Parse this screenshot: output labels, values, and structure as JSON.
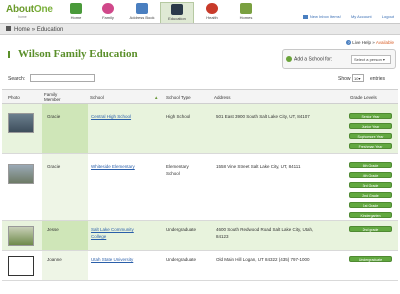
{
  "app": {
    "logo_main": "About",
    "logo_accent": "One",
    "logo_sub": "home"
  },
  "nav": {
    "tabs": [
      {
        "label": "Home",
        "icon": "house-icon",
        "color": "#4a9a3a"
      },
      {
        "label": "Family",
        "icon": "heart-icon",
        "color": "#d0488a"
      },
      {
        "label": "Address Book",
        "icon": "address-book-icon",
        "color": "#4a7fc0"
      },
      {
        "label": "Education",
        "icon": "graduation-cap-icon",
        "color": "#5a8f2a"
      },
      {
        "label": "Health",
        "icon": "apple-icon",
        "color": "#c83a2a"
      },
      {
        "label": "Homes",
        "icon": "homes-icon",
        "color": "#7aa040"
      }
    ],
    "top_links": {
      "inbox": "New Inbox Items!",
      "account": "My Account",
      "logout": "Logout"
    }
  },
  "breadcrumb": {
    "home": "Home",
    "current": "Education"
  },
  "page": {
    "title": "Wilson Family Education",
    "live_help": "Live Help",
    "live_help_status": "Available",
    "add_school_label": "Add a School for:",
    "add_school_select": "Select a person"
  },
  "controls": {
    "search_label": "Search:",
    "show_label": "Show",
    "show_value": "10",
    "entries_label": "entries"
  },
  "table": {
    "headers": {
      "photo": "Photo",
      "family_member": "Family Member",
      "school": "School",
      "school_type": "School Type",
      "address": "Address",
      "grade_levels": "Grade Levels"
    },
    "rows": [
      {
        "member": "Gracie",
        "school": "Central High School",
        "school_line2": "",
        "type": "High School",
        "type_line2": "",
        "address": "501 East 3900 South Salt Lake City, UT, 84107",
        "address_line2": "",
        "grades": [
          "Senior Year",
          "Junior Year",
          "Sophomore Year",
          "Freshman Year"
        ]
      },
      {
        "member": "Gracie",
        "school": "Whiteside Elementary",
        "school_line2": "",
        "type": "Elementary",
        "type_line2": "School",
        "address": "1558 Vine Street Salt Lake City, UT, 84111",
        "address_line2": "",
        "grades": [
          "6th Grade",
          "4th Grade",
          "3rd Grade",
          "2nd Grade",
          "1st Grade",
          "Kindergarten"
        ]
      },
      {
        "member": "Jesse",
        "school": "Salt Lake Community",
        "school_line2": "College",
        "type": "Undergraduate",
        "type_line2": "",
        "address": "4600 South Redwood Road Salt Lake City, Utah,",
        "address_line2": "84123",
        "grades": [
          "2nd grade"
        ]
      },
      {
        "member": "Joanne",
        "school": "Utah State University",
        "school_line2": "",
        "type": "Undergraduate",
        "type_line2": "",
        "address": "Old Main Hill Logan, UT 84322 (435) 797-1000",
        "address_line2": "",
        "grades": [
          "Undergraduate"
        ]
      }
    ]
  },
  "colors": {
    "brand_green": "#5a8f2a",
    "button_green": "#62a840",
    "link_blue": "#2a5faa",
    "row_alt": "#e8f3dd"
  }
}
